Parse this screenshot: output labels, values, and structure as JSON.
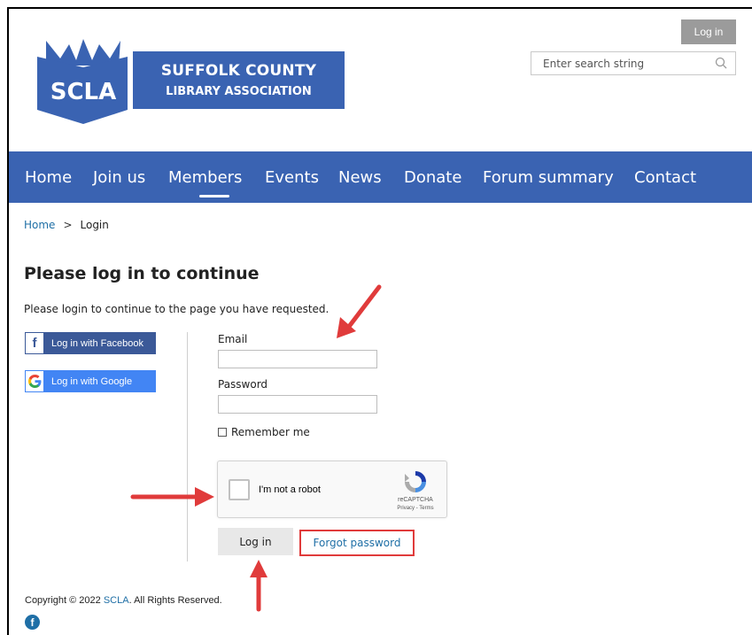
{
  "header": {
    "login_label": "Log in",
    "search_placeholder": "Enter search string",
    "logo_text": "SCLA",
    "logo_line1": "SUFFOLK COUNTY",
    "logo_line2": "LIBRARY ASSOCIATION"
  },
  "nav": {
    "items": [
      "Home",
      "Join us",
      "Members",
      "Events",
      "News",
      "Donate",
      "Forum summary",
      "Contact"
    ],
    "active": "Members"
  },
  "breadcrumb": {
    "home": "Home",
    "separator": ">",
    "current": "Login"
  },
  "page": {
    "title": "Please log in to continue",
    "subtitle": "Please login to continue to the page you have requested."
  },
  "social": {
    "facebook_label": "Log in with Facebook",
    "google_label": "Log in with Google"
  },
  "form": {
    "email_label": "Email",
    "email_value": "",
    "password_label": "Password",
    "password_value": "",
    "remember_label": "Remember me",
    "remember_checked": false,
    "captcha_label": "I'm not a robot",
    "captcha_brand": "reCAPTCHA",
    "captcha_legal": "Privacy - Terms",
    "login_button": "Log in",
    "forgot_link": "Forgot password"
  },
  "footer": {
    "copyright_prefix": "Copyright © 2022 ",
    "copyright_link": "SCLA",
    "copyright_suffix": ". All Rights Reserved."
  },
  "colors": {
    "brand_blue": "#3a63b2",
    "link_blue": "#1f6fa6",
    "annotation_red": "#e03b3b"
  }
}
